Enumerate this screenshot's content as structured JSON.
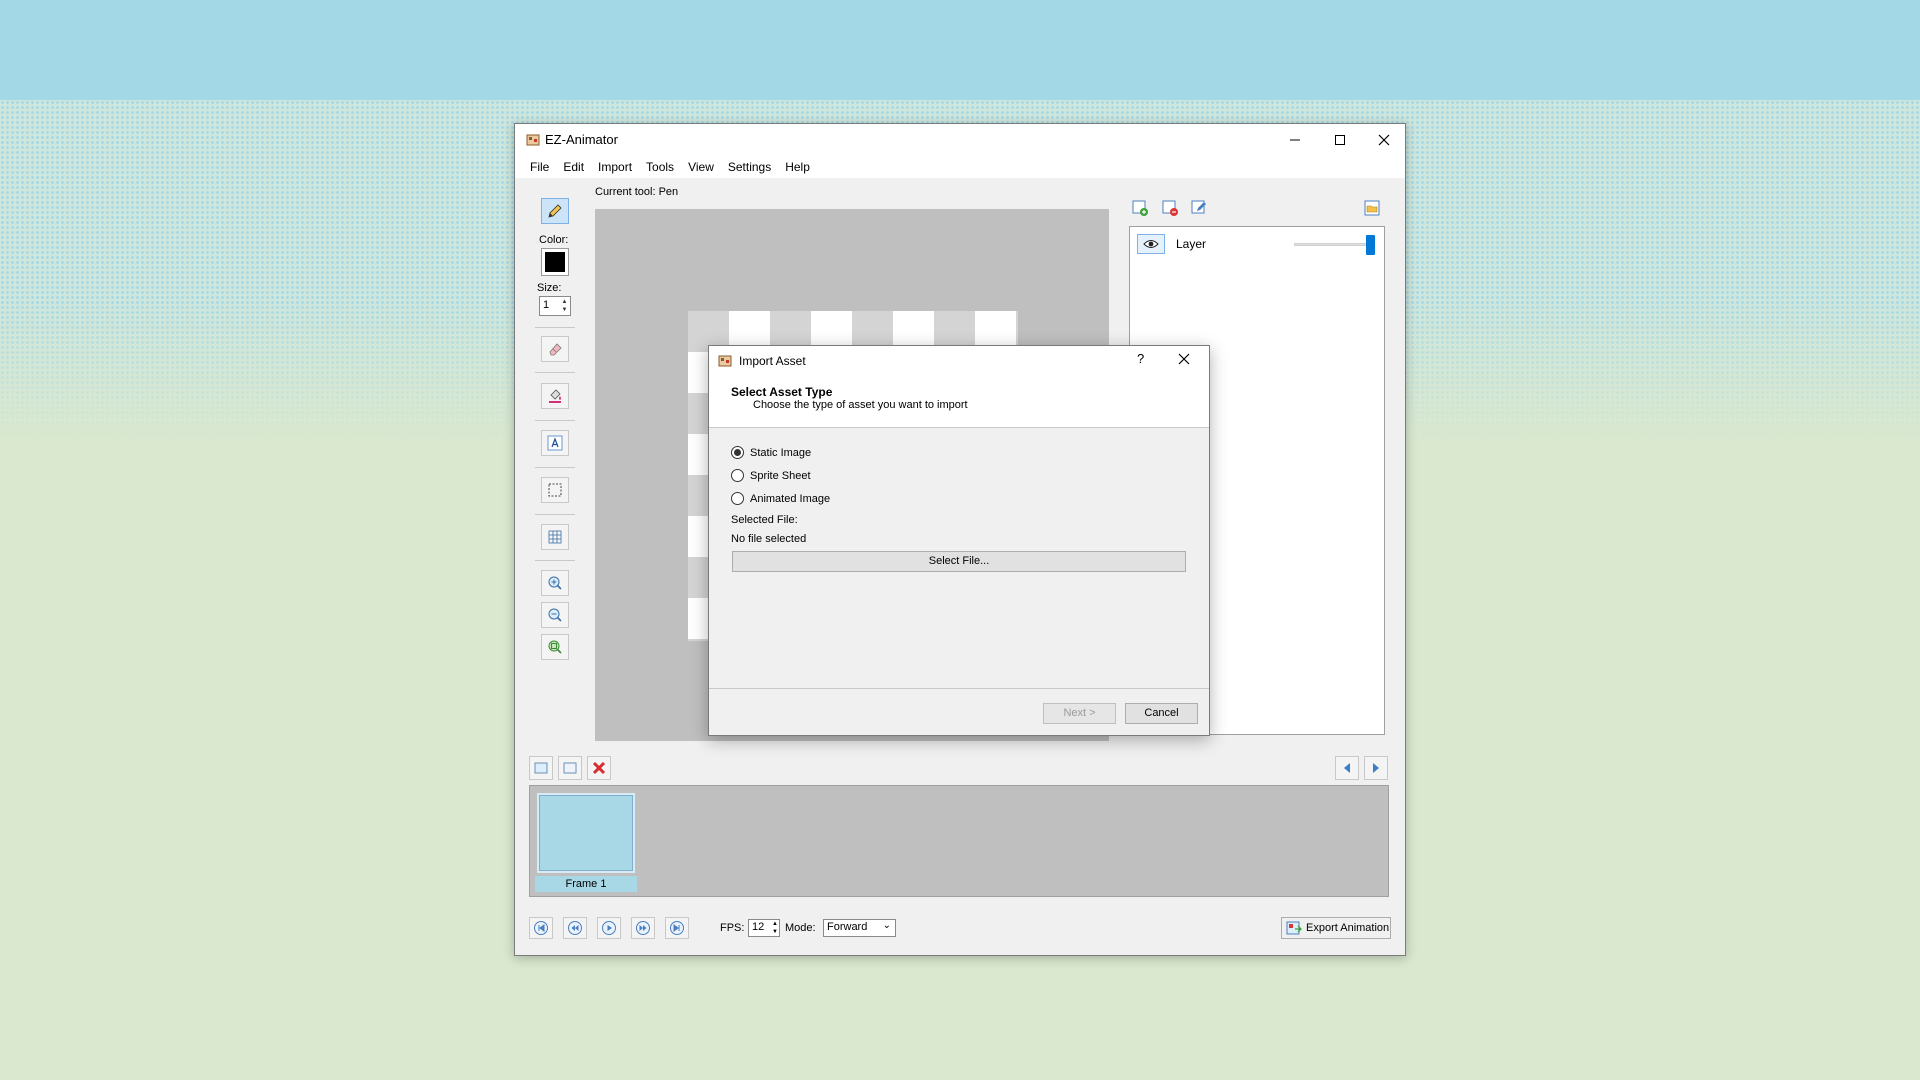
{
  "app": {
    "title": "EZ-Animator",
    "menu": [
      "File",
      "Edit",
      "Import",
      "Tools",
      "View",
      "Settings",
      "Help"
    ]
  },
  "tools": {
    "color_label": "Color:",
    "size_label": "Size:",
    "size_value": "1",
    "current_color": "#000000"
  },
  "canvas": {
    "current_tool": "Current tool: Pen"
  },
  "layers": {
    "items": [
      {
        "name": "Layer",
        "opacity": 1.0
      }
    ]
  },
  "timeline": {
    "frames": [
      {
        "label": "Frame 1"
      }
    ]
  },
  "playback": {
    "fps_label": "FPS:",
    "fps_value": "12",
    "mode_label": "Mode:",
    "mode_value": "Forward",
    "export_label": "Export Animation"
  },
  "dialog": {
    "title": "Import Asset",
    "help": "?",
    "heading": "Select Asset Type",
    "subheading": "Choose the type of asset you want to import",
    "options": [
      {
        "label": "Static Image",
        "selected": true
      },
      {
        "label": "Sprite Sheet",
        "selected": false
      },
      {
        "label": "Animated Image",
        "selected": false
      }
    ],
    "selected_file_label": "Selected File:",
    "selected_file_value": "No file selected",
    "select_file_button": "Select File...",
    "next_button": "Next >",
    "cancel_button": "Cancel"
  }
}
